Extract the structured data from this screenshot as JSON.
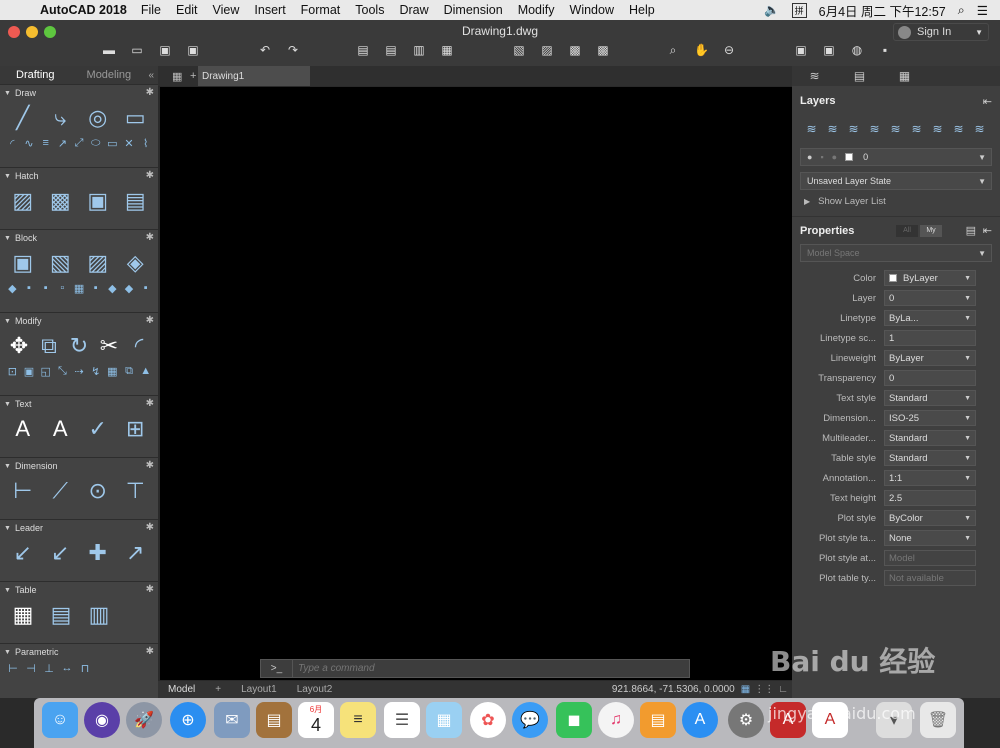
{
  "menubar": {
    "app": "AutoCAD 2018",
    "items": [
      "File",
      "Edit",
      "View",
      "Insert",
      "Format",
      "Tools",
      "Draw",
      "Dimension",
      "Modify",
      "Window",
      "Help"
    ],
    "datetime": "6月4日 周二 下午12:57"
  },
  "window": {
    "title": "Drawing1.dwg",
    "signin": "Sign In"
  },
  "left_tabs": [
    "Drafting",
    "Modeling"
  ],
  "tool_sections": [
    {
      "name": "Draw"
    },
    {
      "name": "Hatch"
    },
    {
      "name": "Block"
    },
    {
      "name": "Modify"
    },
    {
      "name": "Text"
    },
    {
      "name": "Dimension"
    },
    {
      "name": "Leader"
    },
    {
      "name": "Table"
    },
    {
      "name": "Parametric"
    }
  ],
  "drawing_tab": "Drawing1",
  "command": {
    "prompt": ">_",
    "placeholder": "Type a command"
  },
  "status": {
    "layouts": [
      "Model",
      "Layout1",
      "Layout2"
    ],
    "coords": "921.8664, -71.5306, 0.0000"
  },
  "layers": {
    "title": "Layers",
    "current_layer": "0",
    "layer_state": "Unsaved Layer State",
    "show_list": "Show Layer List"
  },
  "properties": {
    "title": "Properties",
    "toggle_all": "All",
    "toggle_my": "My",
    "space": "Model Space",
    "rows": [
      {
        "label": "Color",
        "value": "ByLayer"
      },
      {
        "label": "Layer",
        "value": "0"
      },
      {
        "label": "Linetype",
        "value": "ByLa..."
      },
      {
        "label": "Linetype sc...",
        "value": "1"
      },
      {
        "label": "Lineweight",
        "value": "ByLayer"
      },
      {
        "label": "Transparency",
        "value": "0"
      },
      {
        "label": "Text style",
        "value": "Standard"
      },
      {
        "label": "Dimension...",
        "value": "ISO-25"
      },
      {
        "label": "Multileader...",
        "value": "Standard"
      },
      {
        "label": "Table style",
        "value": "Standard"
      },
      {
        "label": "Annotation...",
        "value": "1:1"
      },
      {
        "label": "Text height",
        "value": "2.5"
      },
      {
        "label": "Plot style",
        "value": "ByColor"
      },
      {
        "label": "Plot style ta...",
        "value": "None"
      },
      {
        "label": "Plot style at...",
        "value": "Model"
      },
      {
        "label": "Plot table ty...",
        "value": "Not available"
      }
    ]
  },
  "dock": {
    "calendar_day": "4",
    "calendar_month": "6月"
  },
  "watermark": {
    "main": "Bai du 经验",
    "sub": "jingyan.baidu.com"
  }
}
